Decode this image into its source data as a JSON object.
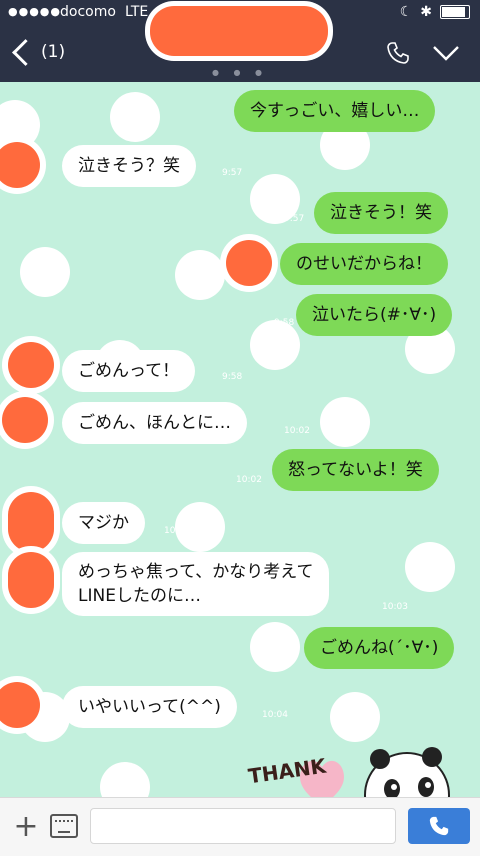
{
  "status_bar": {
    "carrier": "docomo",
    "network": "LTE"
  },
  "header": {
    "unread_count": "(1)"
  },
  "messages": [
    {
      "side": "out",
      "text": "今すっごい、嬉しい…"
    },
    {
      "side": "in",
      "text": "泣きそう？笑",
      "time": "9:57"
    },
    {
      "side": "out",
      "text": "泣きそう！笑",
      "time": "9:57"
    },
    {
      "side": "out",
      "text": "のせいだからね！"
    },
    {
      "side": "out",
      "text": "泣いたら(#･∀･)",
      "time": "9:58"
    },
    {
      "side": "in",
      "text": "ごめんって！",
      "time": "9:58"
    },
    {
      "side": "in",
      "text": "ごめん、ほんとに…",
      "time": "10:02"
    },
    {
      "side": "out",
      "text": "怒ってないよ！笑",
      "time": "10:02"
    },
    {
      "side": "in",
      "text": "マジか",
      "time": "10:03"
    },
    {
      "side": "in",
      "text": "めっちゃ焦って、かなり考えて\nLINEしたのに…",
      "time": "10:03"
    },
    {
      "side": "out",
      "text": "ごめんね(´･∀･)"
    },
    {
      "side": "in",
      "text": "いやいいって(^^)",
      "time": "10:04"
    }
  ],
  "sticker": {
    "text": "THANK"
  },
  "icons": {
    "back": "chevron-left-icon",
    "call": "phone-icon",
    "menu": "chevron-down-icon",
    "plus": "plus-icon",
    "keyboard": "keyboard-icon",
    "send": "phone-send-icon"
  },
  "colors": {
    "header_bg": "#2b3245",
    "chat_bg": "#c3f0dd",
    "outgoing_bubble": "#7ed957",
    "incoming_bubble": "#ffffff",
    "redaction": "#ff6a3d",
    "send_button": "#3a7ed8"
  }
}
